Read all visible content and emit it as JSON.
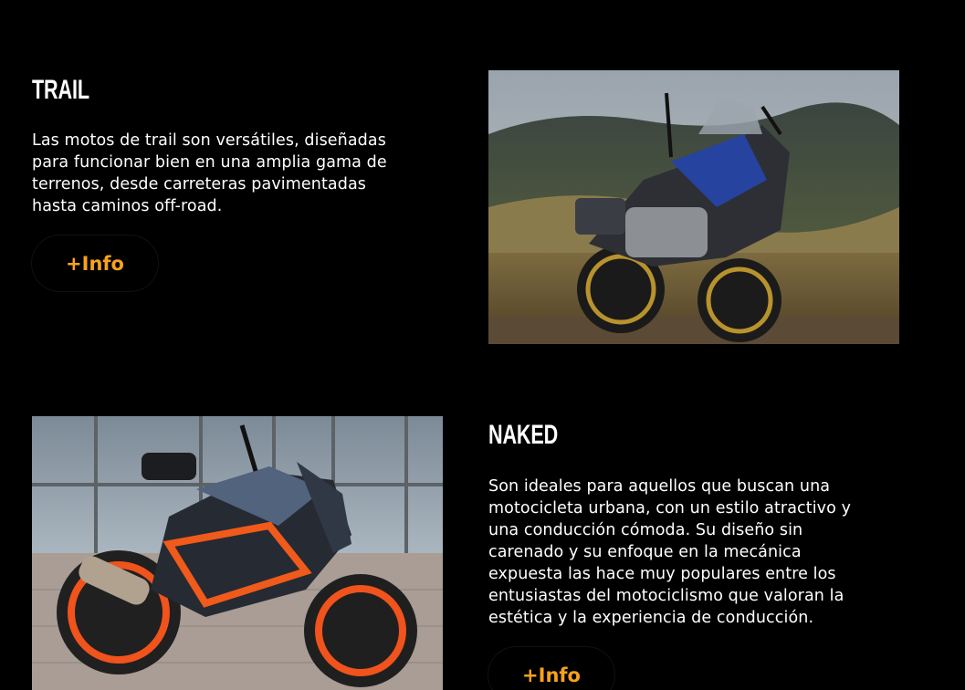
{
  "sections": {
    "trail": {
      "title": "TRAIL",
      "lines": [
        "Las motos de trail son versátiles, diseñadas",
        "para funcionar bien en una amplia gama de",
        "terrenos, desde carreteras pavimentadas",
        "hasta caminos off-road."
      ],
      "button_label": "+Info"
    },
    "naked": {
      "title": "NAKED",
      "lines": [
        "Son ideales para aquellos que buscan una",
        "motocicleta urbana, con un estilo atractivo y",
        "una conducción cómoda. Su diseño sin",
        "carenado y su enfoque en la mecánica",
        "expuesta las hace muy populares entre los",
        "entusiastas del motociclismo que valoran la",
        "estética y la experiencia de conducción."
      ],
      "button_label": "+Info"
    }
  },
  "colors": {
    "background": "#000000",
    "text": "#ffffff",
    "accent": "#f7a21b"
  }
}
